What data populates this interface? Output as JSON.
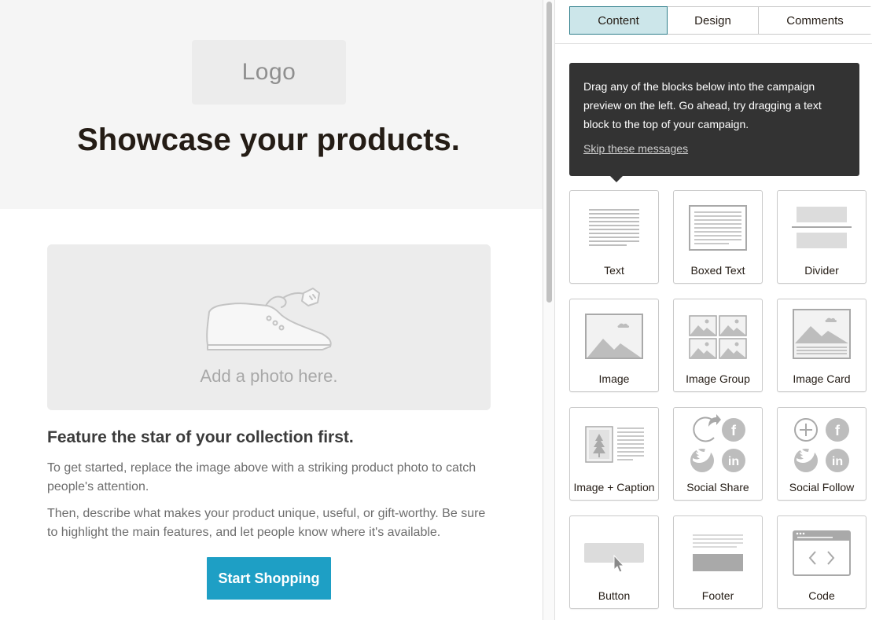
{
  "preview": {
    "logo_text": "Logo",
    "headline": "Showcase your products.",
    "photo_placeholder": "Add a photo here.",
    "feature_title": "Feature the star of your collection first.",
    "paragraph1": "To get started, replace the image above with a striking product photo to catch people's attention.",
    "paragraph2": "Then, describe what makes your product unique, useful, or gift-worthy. Be sure to highlight the main features, and let people know where it's available.",
    "cta_label": "Start Shopping",
    "cta_color": "#1e9fc5"
  },
  "panel": {
    "tabs": [
      {
        "label": "Content",
        "active": true
      },
      {
        "label": "Design",
        "active": false
      },
      {
        "label": "Comments",
        "active": false
      }
    ],
    "tooltip": {
      "text": "Drag any of the blocks below into the campaign preview on the left. Go ahead, try dragging a text block to the top of your campaign.",
      "skip_label": "Skip these messages"
    },
    "blocks": [
      {
        "label": "Text",
        "icon": "text-block-icon"
      },
      {
        "label": "Boxed Text",
        "icon": "boxed-text-block-icon"
      },
      {
        "label": "Divider",
        "icon": "divider-block-icon"
      },
      {
        "label": "Image",
        "icon": "image-block-icon"
      },
      {
        "label": "Image Group",
        "icon": "image-group-block-icon"
      },
      {
        "label": "Image Card",
        "icon": "image-card-block-icon"
      },
      {
        "label": "Image + Caption",
        "icon": "image-caption-block-icon"
      },
      {
        "label": "Social Share",
        "icon": "social-share-block-icon"
      },
      {
        "label": "Social Follow",
        "icon": "social-follow-block-icon"
      },
      {
        "label": "Button",
        "icon": "button-block-icon"
      },
      {
        "label": "Footer",
        "icon": "footer-block-icon"
      },
      {
        "label": "Code",
        "icon": "code-block-icon"
      }
    ]
  },
  "colors": {
    "active_tab_bg": "#cce6ea",
    "tooltip_bg": "#333333"
  }
}
